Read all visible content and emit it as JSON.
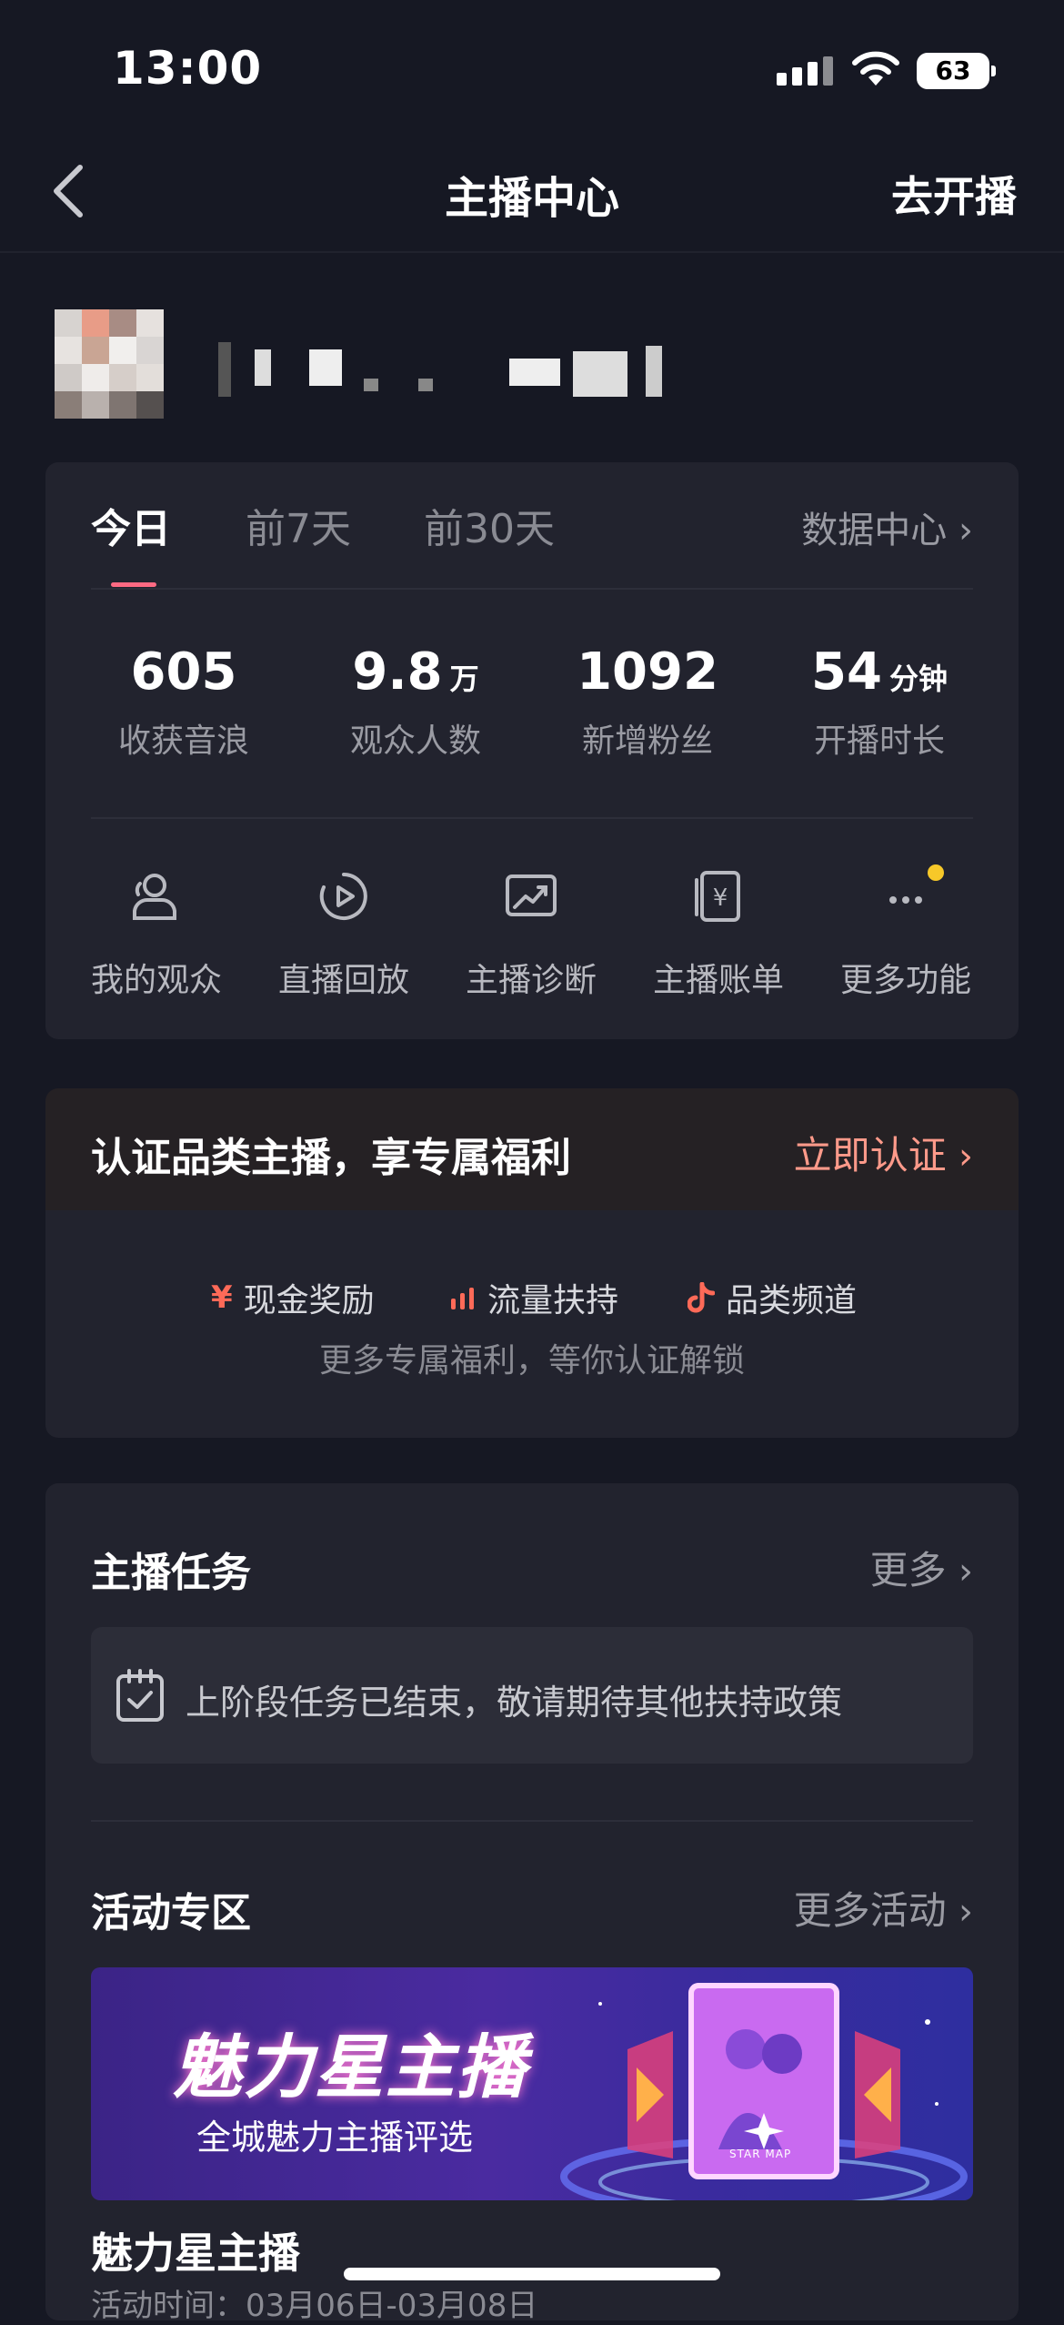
{
  "status_bar": {
    "time": "13:00",
    "battery": "63"
  },
  "nav": {
    "title": "主播中心",
    "go_live": "去开播"
  },
  "tabs": {
    "today": "今日",
    "week": "前7天",
    "month": "前30天",
    "data_center": "数据中心"
  },
  "stats": [
    {
      "value": "605",
      "unit": "",
      "label": "收获音浪"
    },
    {
      "value": "9.8",
      "unit": "万",
      "label": "观众人数"
    },
    {
      "value": "1092",
      "unit": "",
      "label": "新增粉丝"
    },
    {
      "value": "54",
      "unit": "分钟",
      "label": "开播时长"
    }
  ],
  "tools": [
    {
      "label": "我的观众",
      "icon": "audience-icon"
    },
    {
      "label": "直播回放",
      "icon": "replay-icon"
    },
    {
      "label": "主播诊断",
      "icon": "diagnosis-icon"
    },
    {
      "label": "主播账单",
      "icon": "bill-icon"
    },
    {
      "label": "更多功能",
      "icon": "more-icon"
    }
  ],
  "certify": {
    "title": "认证品类主播，享专属福利",
    "link": "立即认证",
    "perks": [
      {
        "icon": "yen-icon",
        "glyph": "¥",
        "label": "现金奖励"
      },
      {
        "icon": "traffic-icon",
        "label": "流量扶持"
      },
      {
        "icon": "douyin-icon",
        "label": "品类频道"
      }
    ],
    "subtitle": "更多专属福利，等你认证解锁"
  },
  "tasks": {
    "title": "主播任务",
    "more": "更多",
    "notice": "上阶段任务已结束，敬请期待其他扶持政策"
  },
  "activities": {
    "title": "活动专区",
    "more": "更多活动",
    "banner_title": "魅力星主播",
    "banner_subtitle": "全城魅力主播评选",
    "banner_badge": "STAR MAP",
    "name": "魅力星主播",
    "time": "活动时间：03月06日-03月08日"
  },
  "colors": {
    "background": "#161823",
    "card": "#22232e",
    "accent": "#fe6a83",
    "notify_dot": "#f7c829"
  }
}
